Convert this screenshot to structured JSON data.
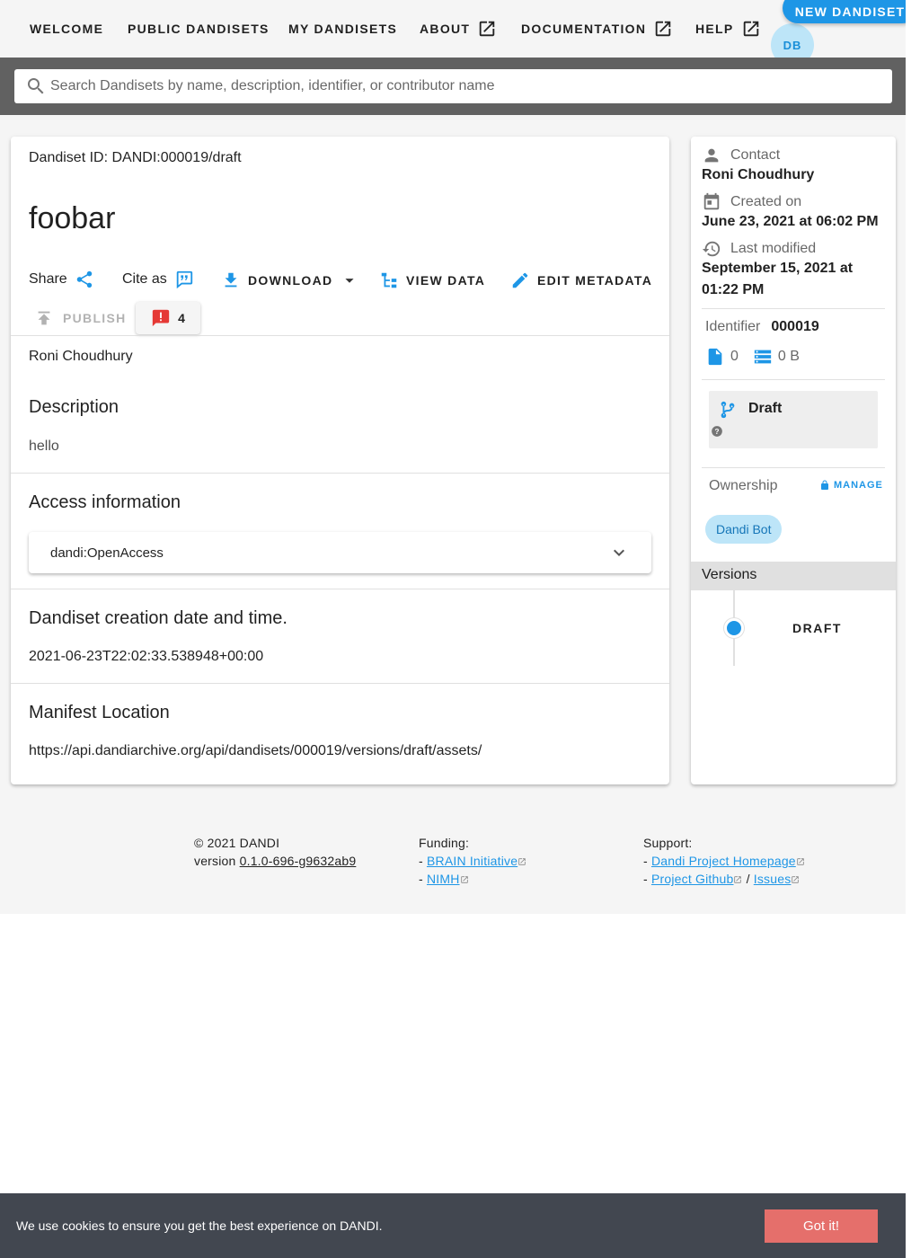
{
  "nav": {
    "items": [
      {
        "label": "WELCOME"
      },
      {
        "label": "PUBLIC DANDISETS"
      },
      {
        "label": "MY DANDISETS"
      },
      {
        "label": "ABOUT"
      },
      {
        "label": "DOCUMENTATION"
      },
      {
        "label": "HELP"
      }
    ],
    "new_dandiset_label": "NEW DANDISET",
    "avatar_initials": "DB"
  },
  "search": {
    "placeholder": "Search Dandisets by name, description, identifier, or contributor name",
    "value": ""
  },
  "dandiset": {
    "id_line": "Dandiset ID: DANDI:000019/draft",
    "title": "foobar",
    "actions": {
      "share": "Share",
      "cite": "Cite as",
      "download": "DOWNLOAD",
      "view_data": "VIEW DATA",
      "edit_metadata": "EDIT METADATA",
      "publish": "PUBLISH",
      "error_count": "4"
    },
    "contributor": "Roni Choudhury",
    "sections": {
      "description_title": "Description",
      "description_text": "hello",
      "access_title": "Access information",
      "access_value": "dandi:OpenAccess",
      "created_title": "Dandiset creation date and time.",
      "created_value": "2021-06-23T22:02:33.538948+00:00",
      "manifest_title": "Manifest Location",
      "manifest_value": "https://api.dandiarchive.org/api/dandisets/000019/versions/draft/assets/"
    }
  },
  "side": {
    "contact_label": "Contact",
    "contact_value": "Roni Choudhury",
    "created_label": "Created on",
    "created_value": "June 23, 2021 at 06:02 PM",
    "modified_label": "Last modified",
    "modified_value": "September 15, 2021 at 01:22 PM",
    "identifier_label": "Identifier",
    "identifier_value": "000019",
    "file_count": "0",
    "size": "0 B",
    "version_state": "Draft",
    "ownership_label": "Ownership",
    "manage_label": "MANAGE",
    "owner": "Dandi Bot",
    "versions_label": "Versions",
    "version_item": "DRAFT"
  },
  "footer": {
    "copyright": "© 2021 DANDI",
    "version_prefix": "version",
    "version": "0.1.0-696-g9632ab9",
    "funding_label": "Funding:",
    "funding_links": [
      "BRAIN Initiative",
      "NIMH"
    ],
    "support_label": "Support:",
    "support_links": [
      "Dandi Project Homepage",
      "Project Github",
      "Issues"
    ],
    "dash": "-",
    "slash": "/"
  },
  "cookie": {
    "text": "We use cookies to ensure you get the best experience on DANDI.",
    "button": "Got it!"
  },
  "colors": {
    "accent": "#1e96e6",
    "search_band": "#616161",
    "cookie_bar": "#424750",
    "cookie_button": "#e56f6b",
    "error_red": "#e53935",
    "chip": "#bde5f8"
  }
}
